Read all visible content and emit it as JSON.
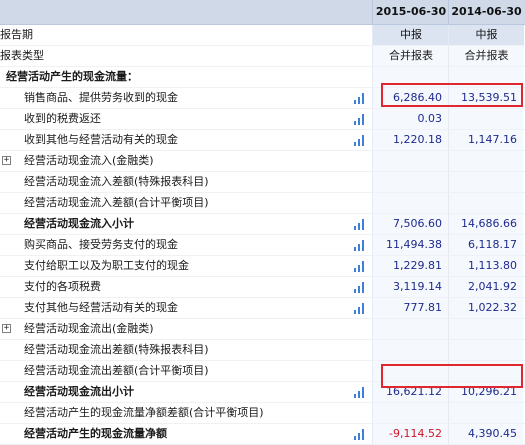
{
  "columns": {
    "col1": "2015-06-30",
    "col2": "2014-06-30"
  },
  "report_period": {
    "label": "报告期",
    "col1": "中报",
    "col2": "中报"
  },
  "report_type": {
    "label": "报表类型",
    "col1": "合并报表",
    "col2": "合并报表"
  },
  "section_title": "经营活动产生的现金流量：",
  "rows": [
    {
      "label": "销售商品、提供劳务收到的现金",
      "col1": "6,286.40",
      "col2": "13,539.51"
    },
    {
      "label": "收到的税费返还",
      "col1": "0.03",
      "col2": ""
    },
    {
      "label": "收到其他与经营活动有关的现金",
      "col1": "1,220.18",
      "col2": "1,147.16"
    },
    {
      "label": "经营活动现金流入(金融类)",
      "col1": "",
      "col2": ""
    },
    {
      "label": "经营活动现金流入差额(特殊报表科目)",
      "col1": "",
      "col2": ""
    },
    {
      "label": "经营活动现金流入差额(合计平衡项目)",
      "col1": "",
      "col2": ""
    },
    {
      "label": "经营活动现金流入小计",
      "col1": "7,506.60",
      "col2": "14,686.66"
    },
    {
      "label": "购买商品、接受劳务支付的现金",
      "col1": "11,494.38",
      "col2": "6,118.17"
    },
    {
      "label": "支付给职工以及为职工支付的现金",
      "col1": "1,229.81",
      "col2": "1,113.80"
    },
    {
      "label": "支付的各项税费",
      "col1": "3,119.14",
      "col2": "2,041.92"
    },
    {
      "label": "支付其他与经营活动有关的现金",
      "col1": "777.81",
      "col2": "1,022.32"
    },
    {
      "label": "经营活动现金流出(金融类)",
      "col1": "",
      "col2": ""
    },
    {
      "label": "经营活动现金流出差额(特殊报表科目)",
      "col1": "",
      "col2": ""
    },
    {
      "label": "经营活动现金流出差额(合计平衡项目)",
      "col1": "",
      "col2": ""
    },
    {
      "label": "经营活动现金流出小计",
      "col1": "16,621.12",
      "col2": "10,296.21"
    },
    {
      "label": "经营活动产生的现金流量净额差额(合计平衡项目)",
      "col1": "",
      "col2": ""
    },
    {
      "label": "经营活动产生的现金流量净额",
      "col1": "-9,114.52",
      "col2": "4,390.45"
    }
  ],
  "icons": {
    "chart": "bar-chart-icon",
    "expand": "expand-plus-icon"
  },
  "expand_symbol": "+",
  "colors": {
    "header_bg": "#cfd9e8",
    "value_text": "#1e2b8e",
    "negative_text": "#d0172a",
    "highlight": "#e0262f",
    "chart_icon": "#3f7fd6"
  }
}
